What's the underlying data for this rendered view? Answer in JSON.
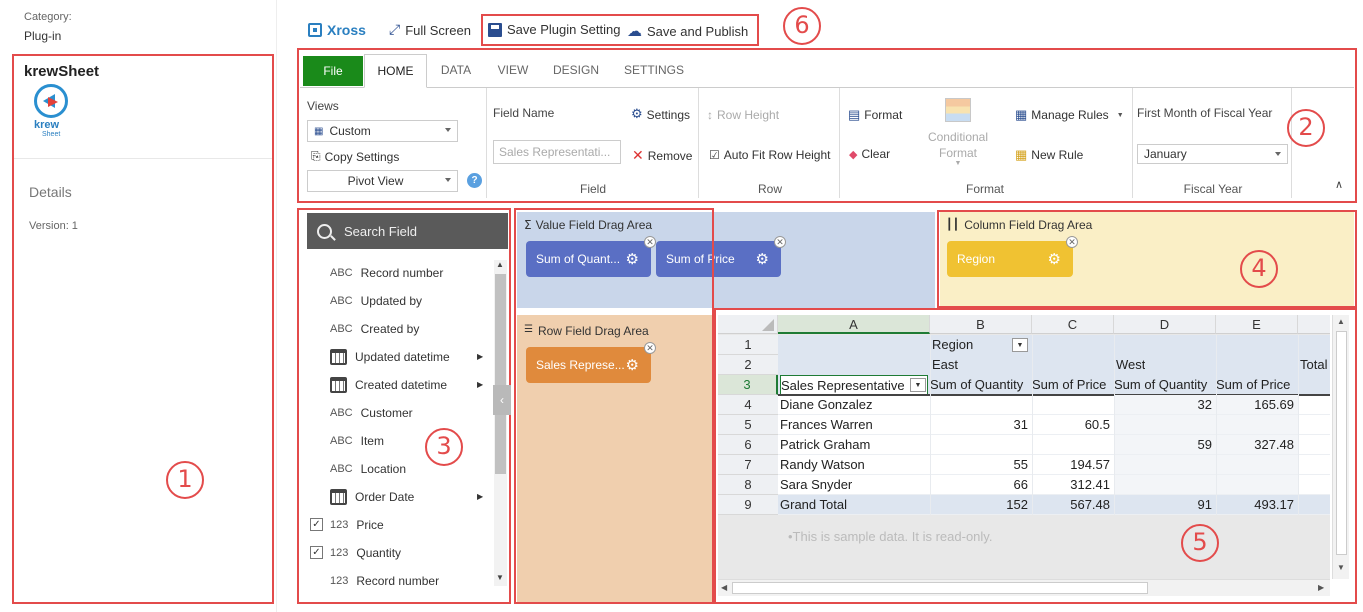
{
  "left_panel": {
    "category_label": "Category:",
    "category_value": "Plug-in",
    "plugin_name": "krewSheet",
    "logo_text_top": "krew",
    "logo_text_bottom": "Sheet",
    "details_label": "Details",
    "version": "Version: 1"
  },
  "toolbar": {
    "xross_label": "Xross",
    "fullscreen_label": "Full Screen",
    "save_plugin_label": "Save Plugin Setting",
    "save_publish_label": "Save and Publish"
  },
  "ribbon": {
    "tabs": [
      "File",
      "HOME",
      "DATA",
      "VIEW",
      "DESIGN",
      "SETTINGS"
    ],
    "views_label": "Views",
    "views_value": "Custom",
    "copy_settings": "Copy Settings",
    "pivot_view": "Pivot View",
    "field_name_label": "Field Name",
    "field_name_placeholder": "Sales Representati...",
    "settings_label": "Settings",
    "remove_label": "Remove",
    "field_group": "Field",
    "row_height": "Row Height",
    "auto_fit": "Auto Fit Row Height",
    "row_group": "Row",
    "format_label": "Format",
    "clear_label": "Clear",
    "conditional_format_1": "Conditional",
    "conditional_format_2": "Format",
    "manage_rules": "Manage Rules",
    "new_rule": "New Rule",
    "format_group": "Format",
    "first_month_label": "First Month of Fiscal Year",
    "month_value": "January",
    "fiscal_group": "Fiscal Year"
  },
  "field_list": {
    "search_label": "Search Field",
    "items": [
      {
        "type": "ABC",
        "label": "Record number",
        "kind": "text"
      },
      {
        "type": "ABC",
        "label": "Updated by",
        "kind": "text"
      },
      {
        "type": "ABC",
        "label": "Created by",
        "kind": "text"
      },
      {
        "type": "cal",
        "label": "Updated datetime",
        "kind": "date"
      },
      {
        "type": "cal",
        "label": "Created datetime",
        "kind": "date"
      },
      {
        "type": "ABC",
        "label": "Customer",
        "kind": "text"
      },
      {
        "type": "ABC",
        "label": "Item",
        "kind": "text"
      },
      {
        "type": "ABC",
        "label": "Location",
        "kind": "text"
      },
      {
        "type": "cal",
        "label": "Order Date",
        "kind": "date"
      },
      {
        "type": "123",
        "label": "Price",
        "kind": "num-checked"
      },
      {
        "type": "123",
        "label": "Quantity",
        "kind": "num-checked"
      },
      {
        "type": "123",
        "label": "Record number",
        "kind": "num"
      }
    ]
  },
  "drag_areas": {
    "value_title": "Value Field Drag Area",
    "value_pill_1": "Sum of Quant...",
    "value_pill_2": "Sum of Price",
    "column_title": "Column Field Drag Area",
    "column_pill": "Region",
    "row_title": "Row Field Drag Area",
    "row_pill": "Sales Represe..."
  },
  "sheet": {
    "columns": [
      "A",
      "B",
      "C",
      "D",
      "E"
    ],
    "rows": [
      "1",
      "2",
      "3",
      "4",
      "5",
      "6",
      "7",
      "8",
      "9"
    ],
    "region_label": "Region",
    "east": "East",
    "west": "West",
    "total": "Total",
    "sales_rep_header": "Sales Representative",
    "sum_qty": "Sum of Quantity",
    "sum_price": "Sum of Price",
    "data": [
      {
        "name": "Diane Gonzalez",
        "b": "",
        "c": "",
        "d": "32",
        "e": "165.69"
      },
      {
        "name": "Frances Warren",
        "b": "31",
        "c": "60.5",
        "d": "",
        "e": ""
      },
      {
        "name": "Patrick Graham",
        "b": "",
        "c": "",
        "d": "59",
        "e": "327.48"
      },
      {
        "name": "Randy Watson",
        "b": "55",
        "c": "194.57",
        "d": "",
        "e": ""
      },
      {
        "name": "Sara Snyder",
        "b": "66",
        "c": "312.41",
        "d": "",
        "e": ""
      },
      {
        "name": "Grand Total",
        "b": "152",
        "c": "567.48",
        "d": "91",
        "e": "493.17"
      }
    ],
    "note": "•This is sample data. It is read-only."
  },
  "annotations": [
    "1",
    "2",
    "3",
    "4",
    "5",
    "6"
  ],
  "colors": {
    "annotation_red": "#e34b4b",
    "file_green": "#1a8a1a",
    "pill_blue": "#5a6fc4",
    "pill_yellow": "#f0c232",
    "pill_orange": "#e08a3c",
    "value_area": "#c9d6ea",
    "column_area": "#faefc6",
    "row_area": "#f0cfae"
  }
}
